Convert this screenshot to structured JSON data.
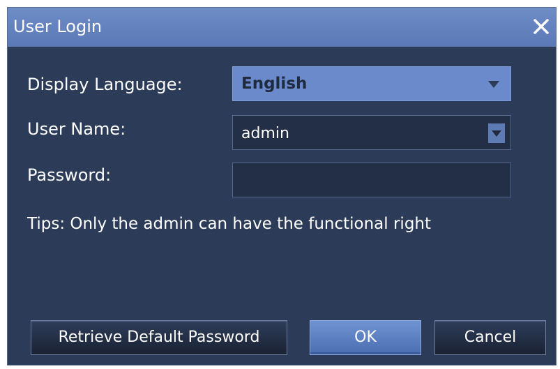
{
  "dialog": {
    "title": "User Login",
    "close_icon": "close-icon"
  },
  "form": {
    "language_label": "Display Language:",
    "language_value": "English",
    "username_label": "User Name:",
    "username_value": "admin",
    "password_label": "Password:",
    "password_value": "",
    "tips": "Tips: Only the admin can have the functional right"
  },
  "buttons": {
    "retrieve_label": "Retrieve Default Password",
    "ok_label": "OK",
    "cancel_label": "Cancel"
  },
  "colors": {
    "titlebar": "#5a79b6",
    "background": "#2b3b58",
    "accent": "#6b8acb"
  }
}
